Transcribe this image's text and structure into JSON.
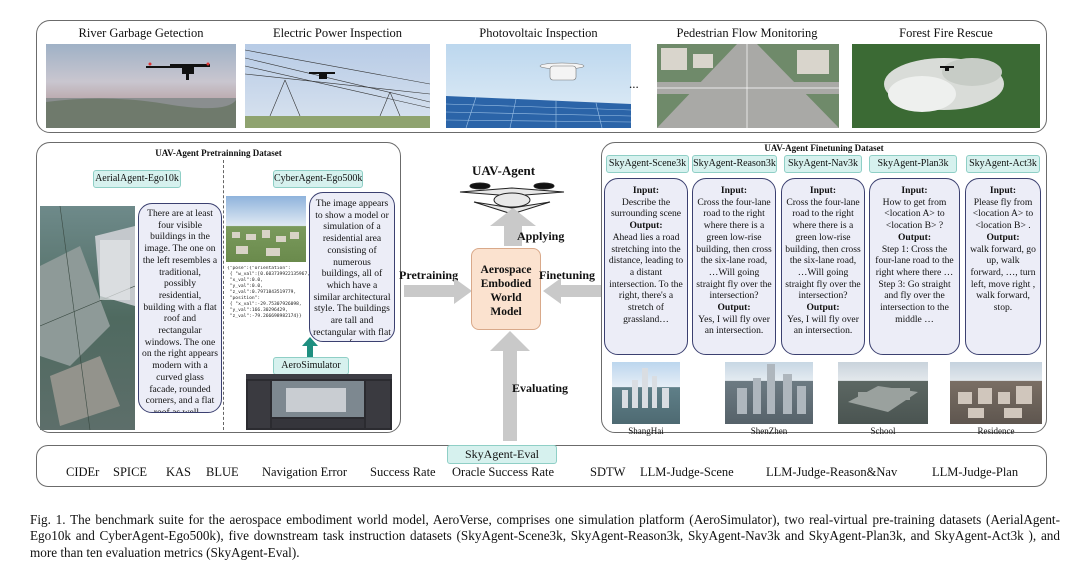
{
  "applications": [
    {
      "label": "River Garbage Getection"
    },
    {
      "label": "Electric Power Inspection"
    },
    {
      "label": "Photovoltaic Inspection"
    },
    {
      "label": "Pedestrian Flow Monitoring"
    },
    {
      "label": "Forest Fire Rescue"
    }
  ],
  "ellipsis": "...",
  "pretraining": {
    "title": "UAV-Agent Pretrainning Dataset",
    "aerial_tag": "AerialAgent-Ego10k",
    "aerial_text": "There are at least four visible buildings in the image. The one on the left resembles a traditional, possibly residential, building with a flat roof and rectangular windows. The one on the right appears modern with a curved glass facade, rounded corners, and a flat roof as well...",
    "cyber_tag": "CyberAgent-Ego500k",
    "cyber_text": "The image appears to show a model or simulation of a residential area consisting of numerous buildings, all of which have a similar architectural style. The buildings are tall and rectangular with flat roofs. ...",
    "simulator_tag": "AeroSimulator",
    "code_lines": "{\"pose\":{\"orientation\":\n { \"w_val\":[0.603739922135967,\n \"x_val\":0.0,\n \"y_val\":0.0,\n \"z_val\":0.7971843519779,\n \"position\":\n { \"x_val\":-29.75307926098,\n \"y_val\":166.30296429,\n \"z_val\":-79.266698982174}}"
  },
  "center": {
    "uav_agent": "UAV-Agent",
    "applying": "Applying",
    "pretraining": "Pretraining",
    "finetuning": "Finetuning",
    "evaluating": "Evaluating",
    "model_line1": "Aerospace",
    "model_line2": "Embodied",
    "model_line3": "World",
    "model_line4": "Model"
  },
  "finetuning": {
    "title": "UAV-Agent Finetuning Dataset",
    "tasks": [
      {
        "tag": "SkyAgent-Scene3k",
        "input_label": "Input:",
        "input": "Describe the surrounding scene",
        "output_label": "Output:",
        "output": "Ahead lies a road stretching into the distance, leading to a distant intersection. To the right, there's a stretch of grassland…"
      },
      {
        "tag": "SkyAgent-Reason3k",
        "input_label": "Input:",
        "input": "Cross the four-lane road to the right where there is a green low-rise building, then cross the six-lane road, …Will going straight fly over the intersection?",
        "output_label": "Output:",
        "output": "Yes, I will fly over an intersection."
      },
      {
        "tag": "SkyAgent-Nav3k",
        "input_label": "Input:",
        "input": "Cross the four-lane road to the right where there is a green low-rise building, then cross the six-lane road, …Will going straight fly over the intersection?",
        "output_label": "Output:",
        "output": "Yes, I will fly over an intersection."
      },
      {
        "tag": "SkyAgent-Plan3k",
        "input_label": "Input:",
        "input": "How to get from <location A> to <location B> ?",
        "output_label": "Output:",
        "output": "Step 1: Cross the four-lane road to the right where there … Step 3: Go straight and fly over the intersection to the middle …"
      },
      {
        "tag": "SkyAgent-Act3k",
        "input_label": "Input:",
        "input": "Please fly from <location A> to <location B> .",
        "output_label": "Output:",
        "output": "walk forward, go up, walk forward, …, turn left, move right , walk forward, stop."
      }
    ],
    "cities": [
      "ShangHai",
      "ShenZhen",
      "School",
      "Residence"
    ]
  },
  "eval": {
    "tag": "SkyAgent-Eval",
    "metrics": [
      "CIDEr",
      "SPICE",
      "KAS",
      "BLUE",
      "Navigation Error",
      "Success Rate",
      "Oracle Success Rate",
      "SDTW",
      "LLM-Judge-Scene",
      "LLM-Judge-Reason&Nav",
      "LLM-Judge-Plan"
    ]
  },
  "caption": {
    "label": "Fig. 1.",
    "text": "The benchmark suite for the aerospace embodiment world model, AeroVerse, comprises one simulation platform (AeroSimulator), two real-virtual pre-training datasets (AerialAgent-Ego10k and CyberAgent-Ego500k), five downstream task instruction datasets (SkyAgent-Scene3k, SkyAgent-Reason3k, SkyAgent-Nav3k and SkyAgent-Plan3k, and SkyAgent-Act3k ), and more than ten evaluation metrics (SkyAgent-Eval)."
  },
  "colors": {
    "tag_fill": "#d6f1ee",
    "bubble_fill": "#ecedf7",
    "model_fill": "#fbe2cf",
    "arrow": "#c9c9c9",
    "sim_arrow": "#1f8f80"
  }
}
